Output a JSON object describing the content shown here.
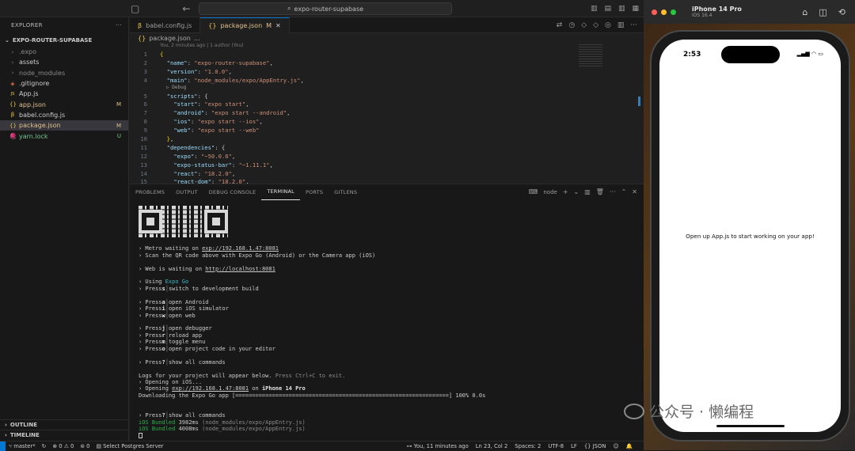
{
  "vscode": {
    "search_text": "expo-router-supabase",
    "sidebar": {
      "title": "EXPLORER",
      "root": "EXPO-ROUTER-SUPABASE",
      "items": [
        {
          "icon": "chevron-right",
          "name": ".expo",
          "status": "",
          "color": "#8a8a8a"
        },
        {
          "icon": "chevron-right",
          "name": "assets",
          "status": "",
          "color": "#cccccc"
        },
        {
          "icon": "chevron-right",
          "name": "node_modules",
          "status": "",
          "color": "#8a8a8a"
        },
        {
          "icon": "gitignore",
          "name": ".gitignore",
          "status": "",
          "color": "#cccccc"
        },
        {
          "icon": "js",
          "name": "App.js",
          "status": "",
          "color": "#cccccc"
        },
        {
          "icon": "json",
          "name": "app.json",
          "status": "M",
          "color": "#e2c08d"
        },
        {
          "icon": "babel",
          "name": "babel.config.js",
          "status": "",
          "color": "#cccccc"
        },
        {
          "icon": "json",
          "name": "package.json",
          "status": "M",
          "color": "#e2c08d"
        },
        {
          "icon": "yarn",
          "name": "yarn.lock",
          "status": "U",
          "color": "#73c991"
        }
      ],
      "outline": "OUTLINE",
      "timeline": "TIMELINE"
    },
    "tabs": [
      {
        "name": "babel.config.js",
        "modified": "",
        "active": false
      },
      {
        "name": "package.json",
        "modified": "M",
        "active": true
      }
    ],
    "breadcrumb": "package.json",
    "breadcrumb_more": "...",
    "blame": "You, 2 minutes ago | 1 author (You)",
    "debug_label": "Debug",
    "code_lines": [
      {
        "n": "1",
        "t": "{"
      },
      {
        "n": "2",
        "t": "  \"name\": \"expo-router-supabase\","
      },
      {
        "n": "3",
        "t": "  \"version\": \"1.0.0\","
      },
      {
        "n": "4",
        "t": "  \"main\": \"node_modules/expo/AppEntry.js\","
      },
      {
        "n": "5",
        "t": "  \"scripts\": {"
      },
      {
        "n": "6",
        "t": "    \"start\": \"expo start\","
      },
      {
        "n": "7",
        "t": "    \"android\": \"expo start --android\","
      },
      {
        "n": "8",
        "t": "    \"ios\": \"expo start --ios\","
      },
      {
        "n": "9",
        "t": "    \"web\": \"expo start --web\""
      },
      {
        "n": "10",
        "t": "  },"
      },
      {
        "n": "11",
        "t": "  \"dependencies\": {"
      },
      {
        "n": "12",
        "t": "    \"expo\": \"~50.0.6\","
      },
      {
        "n": "13",
        "t": "    \"expo-status-bar\": \"~1.11.1\","
      },
      {
        "n": "14",
        "t": "    \"react\": \"18.2.0\","
      },
      {
        "n": "15",
        "t": "    \"react-dom\": \"18.2.0\","
      }
    ],
    "panel_tabs": [
      {
        "name": "PROBLEMS",
        "active": false
      },
      {
        "name": "OUTPUT",
        "active": false
      },
      {
        "name": "DEBUG CONSOLE",
        "active": false
      },
      {
        "name": "TERMINAL",
        "active": true
      },
      {
        "name": "PORTS",
        "active": false
      },
      {
        "name": "GITLENS",
        "active": false
      }
    ],
    "terminal_name": "node",
    "terminal": {
      "metro_prefix": "› Metro waiting on ",
      "metro_url": "exp://192.168.1.47:8081",
      "scan": "› Scan the QR code above with Expo Go (Android) or the Camera app (iOS)",
      "web_prefix": "› Web is waiting on ",
      "web_url": "http://localhost:8081",
      "using_prefix": "› Using ",
      "using_val": "Expo Go",
      "press_rows_1": [
        {
          "key": "s",
          "desc": "switch to development build"
        }
      ],
      "press_rows_2": [
        {
          "key": "a",
          "desc": "open Android"
        },
        {
          "key": "i",
          "desc": "open iOS simulator"
        },
        {
          "key": "w",
          "desc": "open web"
        }
      ],
      "press_rows_3": [
        {
          "key": "j",
          "desc": "open debugger"
        },
        {
          "key": "r",
          "desc": "reload app"
        },
        {
          "key": "m",
          "desc": "toggle menu"
        },
        {
          "key": "o",
          "desc": "open project code in your editor"
        }
      ],
      "press_word": "› Press",
      "help_key": "?",
      "help_desc": "show all commands",
      "logs_prefix": "Logs for your project will appear below. ",
      "logs_hint": "Press Ctrl+C to exit.",
      "opening_ios": "› Opening on iOS...",
      "opening_prefix": "› Opening ",
      "opening_url": "exp://192.168.1.47:8081",
      "opening_mid": " on ",
      "opening_device": "iPhone 14 Pro",
      "download": "Downloading the Expo Go app [================================================================] 100% 0.0s",
      "bundled": [
        {
          "tag": "iOS Bundled",
          "ms": "3982ms",
          "path": "(node_modules/expo/AppEntry.js)"
        },
        {
          "tag": "iOS Bundled",
          "ms": "4008ms",
          "path": "(node_modules/expo/AppEntry.js)"
        }
      ]
    },
    "status": {
      "branch": "master*",
      "errors": "0",
      "warnings": "0",
      "ports": "0",
      "select_server": "Select Postgres Server",
      "blame": "You, 11 minutes ago",
      "position": "Ln 23, Col 2",
      "spaces": "Spaces: 2",
      "encoding": "UTF-8",
      "eol": "LF",
      "language": "JSON"
    }
  },
  "simulator": {
    "device": "iPhone 14 Pro",
    "os": "iOS 16.4",
    "time": "2:53",
    "message": "Open up App.js to start working on your app!"
  },
  "watermark": "公众号 · 懒编程",
  "colors": {
    "accent": "#0078d4",
    "modified": "#e2c08d",
    "untracked": "#73c991",
    "expo_cyan": "#3fb6c4",
    "bundled_green": "#2ab04b"
  }
}
